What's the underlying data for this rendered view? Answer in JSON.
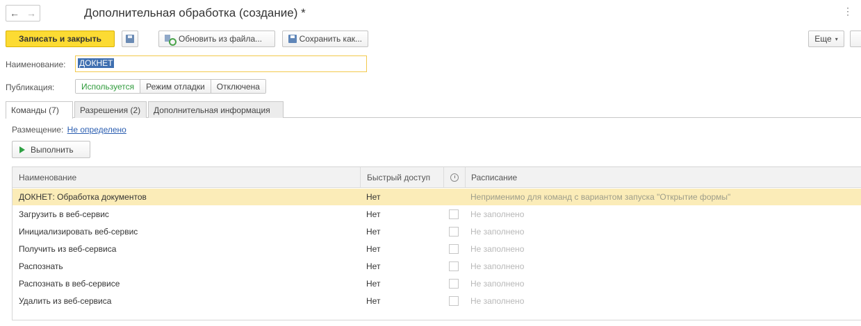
{
  "window": {
    "title": "Дополнительная обработка (создание) *",
    "back_icon": "←",
    "forward_icon": "→",
    "menu_icon": "⋮"
  },
  "toolbar": {
    "save_close_label": "Записать и закрыть",
    "update_label": "Обновить из файла...",
    "save_as_label": "Сохранить как...",
    "more_label": "Еще",
    "more_caret": "▾"
  },
  "form": {
    "name_label": "Наименование:",
    "name_value": "ДОКНЕТ",
    "publication_label": "Публикация:",
    "publication_options": [
      "Используется",
      "Режим отладки",
      "Отключена"
    ],
    "publication_selected": "Используется"
  },
  "tabs": [
    {
      "label": "Команды (7)"
    },
    {
      "label": "Разрешения (2)"
    },
    {
      "label": "Дополнительная информация"
    }
  ],
  "placement": {
    "label": "Размещение:",
    "link": "Не определено"
  },
  "run_button_label": "Выполнить",
  "table": {
    "columns": {
      "name": "Наименование",
      "fast_access": "Быстрый доступ",
      "schedule": "Расписание"
    },
    "rows": [
      {
        "name": "ДОКНЕТ: Обработка документов",
        "fast_access": "Нет",
        "schedule": "Неприменимо для команд с вариантом запуска \"Открытие формы\""
      },
      {
        "name": "Загрузить в веб-сервис",
        "fast_access": "Нет",
        "schedule": "Не заполнено"
      },
      {
        "name": "Инициализировать веб-сервис",
        "fast_access": "Нет",
        "schedule": "Не заполнено"
      },
      {
        "name": "Получить из веб-сервиса",
        "fast_access": "Нет",
        "schedule": "Не заполнено"
      },
      {
        "name": "Распознать",
        "fast_access": "Нет",
        "schedule": "Не заполнено"
      },
      {
        "name": "Распознать в веб-сервисе",
        "fast_access": "Нет",
        "schedule": "Не заполнено"
      },
      {
        "name": "Удалить из веб-сервиса",
        "fast_access": "Нет",
        "schedule": "Не заполнено"
      }
    ]
  },
  "colors": {
    "primary_button": "#fcdb33",
    "selected_row": "#fbecb8",
    "link": "#2a5db0",
    "active_publication": "#2e9a3a"
  }
}
